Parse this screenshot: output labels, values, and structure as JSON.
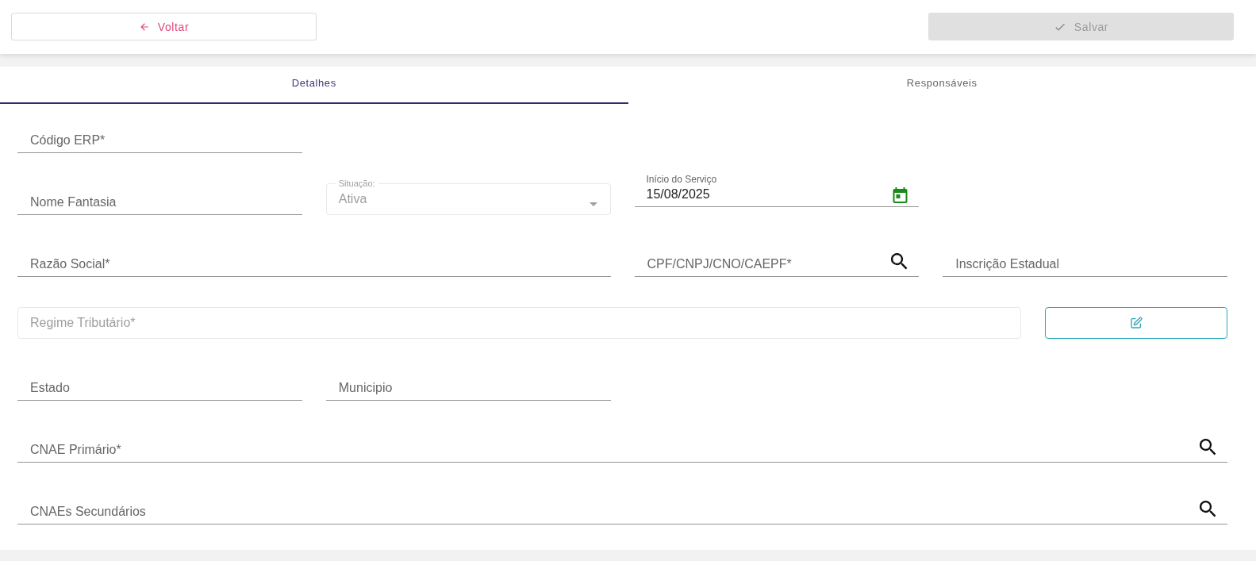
{
  "toolbar": {
    "back_button": {
      "label": "Voltar"
    },
    "save_button": {
      "label": "Salvar",
      "disabled": true
    }
  },
  "tabs": [
    {
      "label": "Detalhes",
      "selected": true
    },
    {
      "label": "Responsáveis",
      "selected": false
    }
  ],
  "form_rows": [
    [
      {
        "kind": "underline",
        "placeholder": "Código ERP*"
      }
    ],
    [
      {
        "kind": "underline",
        "placeholder": "Nome Fantasia"
      },
      {
        "kind": "select",
        "label": "Situação:",
        "value": "Ativa",
        "disabled": true
      },
      {
        "kind": "date",
        "label": "Início do Serviço",
        "value": "15/08/2025"
      }
    ],
    [
      {
        "kind": "underline",
        "placeholder": "Razão Social*"
      },
      {
        "kind": "underline",
        "placeholder": "CPF/CNPJ/CNO/CAEPF*",
        "search": true
      },
      {
        "kind": "underline",
        "placeholder": "Inscrição Estadual"
      }
    ],
    [
      {
        "kind": "outlined",
        "placeholder": "Regime Tributário*",
        "disabled": true
      },
      {
        "kind": "edit-button"
      }
    ],
    [
      {
        "kind": "underline",
        "placeholder": "Estado"
      },
      {
        "kind": "underline",
        "placeholder": "Municipio"
      }
    ],
    [
      {
        "kind": "underline",
        "placeholder": "CNAE Primário*",
        "search": true
      }
    ],
    [
      {
        "kind": "underline",
        "placeholder": "CNAEs Secundários",
        "search": true
      }
    ]
  ]
}
